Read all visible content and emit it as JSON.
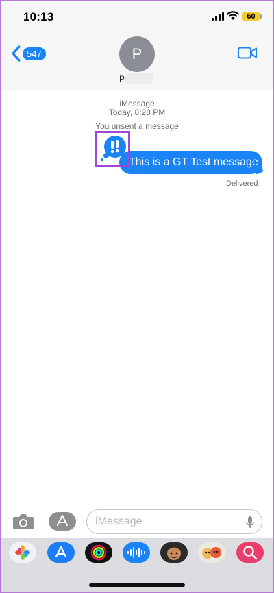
{
  "status_bar": {
    "time": "10:13",
    "battery_level": "60"
  },
  "header": {
    "back_count": "547",
    "avatar_initial": "P",
    "contact_name": "P",
    "icons": [
      "back-chevron-icon",
      "video-camera-icon"
    ]
  },
  "conversation": {
    "service_label": "iMessage",
    "timestamp": "Today, 8:28 PM",
    "unsent_notice": "You unsent a message",
    "message_text": "This is a GT Test message",
    "delivery_status": "Delivered",
    "effect_icon": "exclamation-bubble-icon"
  },
  "input_bar": {
    "placeholder": "iMessage",
    "value": "",
    "icons": [
      "camera-icon",
      "app-store-icon",
      "microphone-icon"
    ]
  },
  "app_drawer": {
    "apps": [
      "photos-app-icon",
      "app-store-app-icon",
      "fitness-app-icon",
      "audio-message-app-icon",
      "memoji-app-icon",
      "memoji-stickers-app-icon",
      "image-search-app-icon"
    ]
  },
  "colors": {
    "accent": "#1a84f6",
    "battery": "#f5cd2e",
    "highlight": "#9a4ad6",
    "search_app": "#ea3d6c"
  }
}
